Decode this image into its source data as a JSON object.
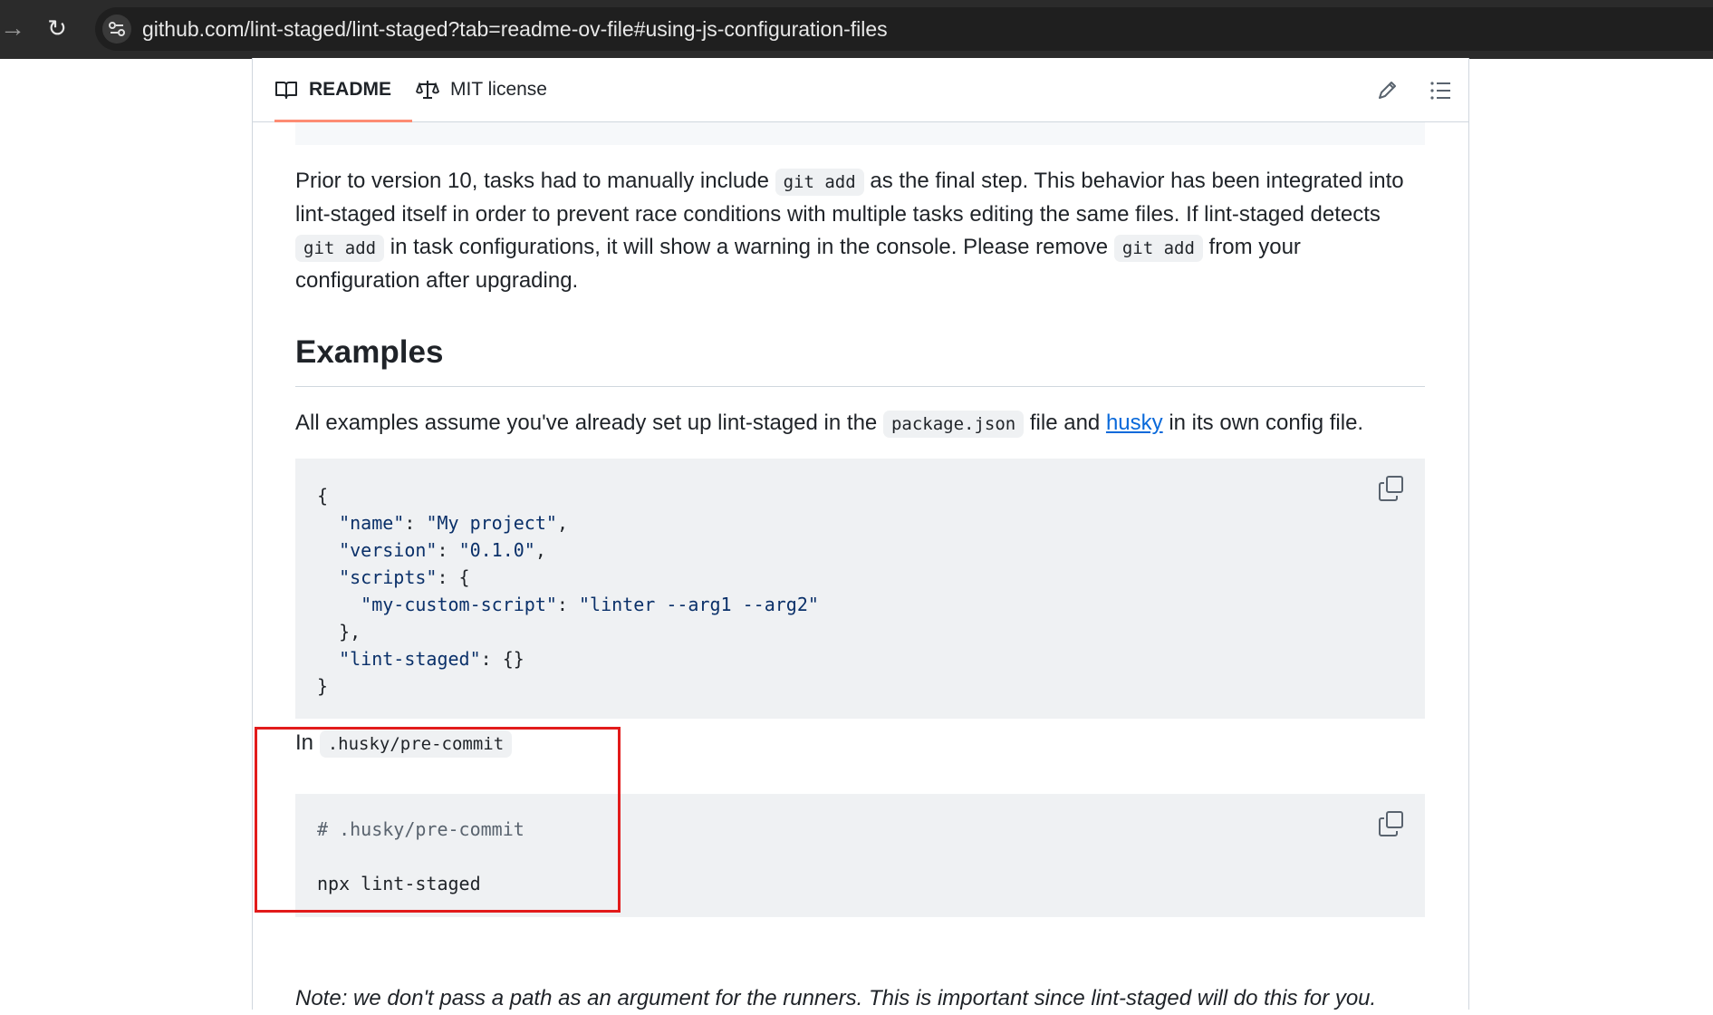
{
  "browser": {
    "url": "github.com/lint-staged/lint-staged?tab=readme-ov-file#using-js-configuration-files",
    "forward_icon": "arrow-right-icon",
    "reload_icon": "reload-icon",
    "site_info_icon": "tune-icon"
  },
  "tabs": [
    {
      "label": "README",
      "icon": "book-icon",
      "active": true
    },
    {
      "label": "MIT license",
      "icon": "law-icon",
      "active": false
    }
  ],
  "toolbar": {
    "edit_icon": "pencil-icon",
    "outline_icon": "list-icon"
  },
  "intro": {
    "t1": "Prior to version 10, tasks had to manually include ",
    "c1": "git add",
    "t2": " as the final step. This behavior has been integrated into lint-staged itself in order to prevent race conditions with multiple tasks editing the same files. If lint-staged detects ",
    "c2": "git add",
    "t3": " in task configurations, it will show a warning in the console. Please remove ",
    "c3": "git add",
    "t4": " from your configuration after upgrading."
  },
  "examples": {
    "heading": "Examples",
    "t1": "All examples assume you've already set up lint-staged in the ",
    "c1": "package.json",
    "t2": " file and ",
    "link": "husky",
    "t3": " in its own config file."
  },
  "code_json": {
    "l1": "{",
    "l2_indent": "  ",
    "l2_key": "\"name\"",
    "l2_sep": ": ",
    "l2_val": "\"My project\"",
    "l2_end": ",",
    "l3_indent": "  ",
    "l3_key": "\"version\"",
    "l3_sep": ": ",
    "l3_val": "\"0.1.0\"",
    "l3_end": ",",
    "l4_indent": "  ",
    "l4_key": "\"scripts\"",
    "l4_rest": ": {",
    "l5_indent": "    ",
    "l5_key": "\"my-custom-script\"",
    "l5_sep": ": ",
    "l5_val": "\"linter --arg1 --arg2\"",
    "l6": "  },",
    "l7_indent": "  ",
    "l7_key": "\"lint-staged\"",
    "l7_rest": ": {}",
    "l8": "}"
  },
  "in_husky": {
    "t1": "In ",
    "c1": ".husky/pre-commit"
  },
  "code_sh": {
    "l1": "# .husky/pre-commit",
    "l2": "",
    "l3": "npx lint-staged"
  },
  "copy_icon": "copy-icon",
  "note": "Note: we don't pass a path as an argument for the runners. This is important since lint-staged will do this for you.",
  "colors": {
    "accent_tab": "#fd8c73",
    "link": "#0969da",
    "annotation": "#e21b1b",
    "code_bg": "#eff1f3"
  }
}
